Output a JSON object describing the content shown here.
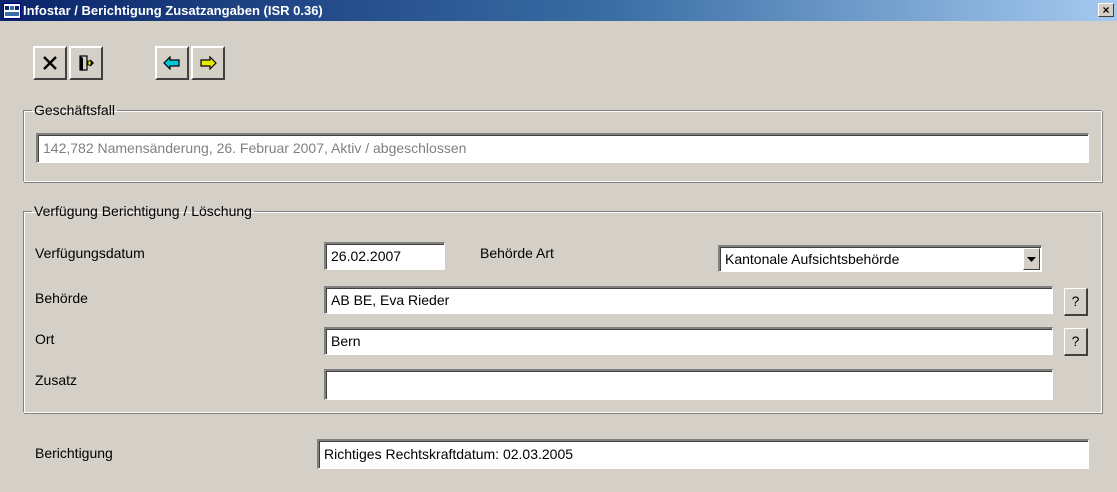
{
  "window": {
    "title": "Infostar / Berichtigung Zusatzangaben (ISR 0.36)",
    "app_icon": "app-icon",
    "close_label": "×"
  },
  "toolbar": {
    "buttons": [
      {
        "name": "cancel-button",
        "icon": "x-icon"
      },
      {
        "name": "exit-button",
        "icon": "exit-door-icon"
      },
      {
        "name": "previous-button",
        "icon": "arrow-left-icon",
        "color": "#00c8d8"
      },
      {
        "name": "next-button",
        "icon": "arrow-right-icon",
        "color": "#e8e800"
      }
    ]
  },
  "geschaeftsfall": {
    "legend": "Geschäftsfall",
    "value": "142,782  Namensänderung, 26. Februar 2007, Aktiv / abgeschlossen"
  },
  "verfuegung": {
    "legend": "Verfügung Berichtigung / Löschung",
    "verfuegungsdatum_label": "Verfügungsdatum",
    "verfuegungsdatum_value": "26.02.2007",
    "behoerde_art_label": "Behörde Art",
    "behoerde_art_value": "Kantonale Aufsichtsbehörde",
    "behoerde_label": "Behörde",
    "behoerde_value": "AB BE, Eva Rieder",
    "ort_label": "Ort",
    "ort_value": "Bern",
    "zusatz_label": "Zusatz",
    "zusatz_value": "",
    "help_label": "?"
  },
  "berichtigung": {
    "label": "Berichtigung",
    "value": "Richtiges Rechtskraftdatum: 02.03.2005"
  }
}
